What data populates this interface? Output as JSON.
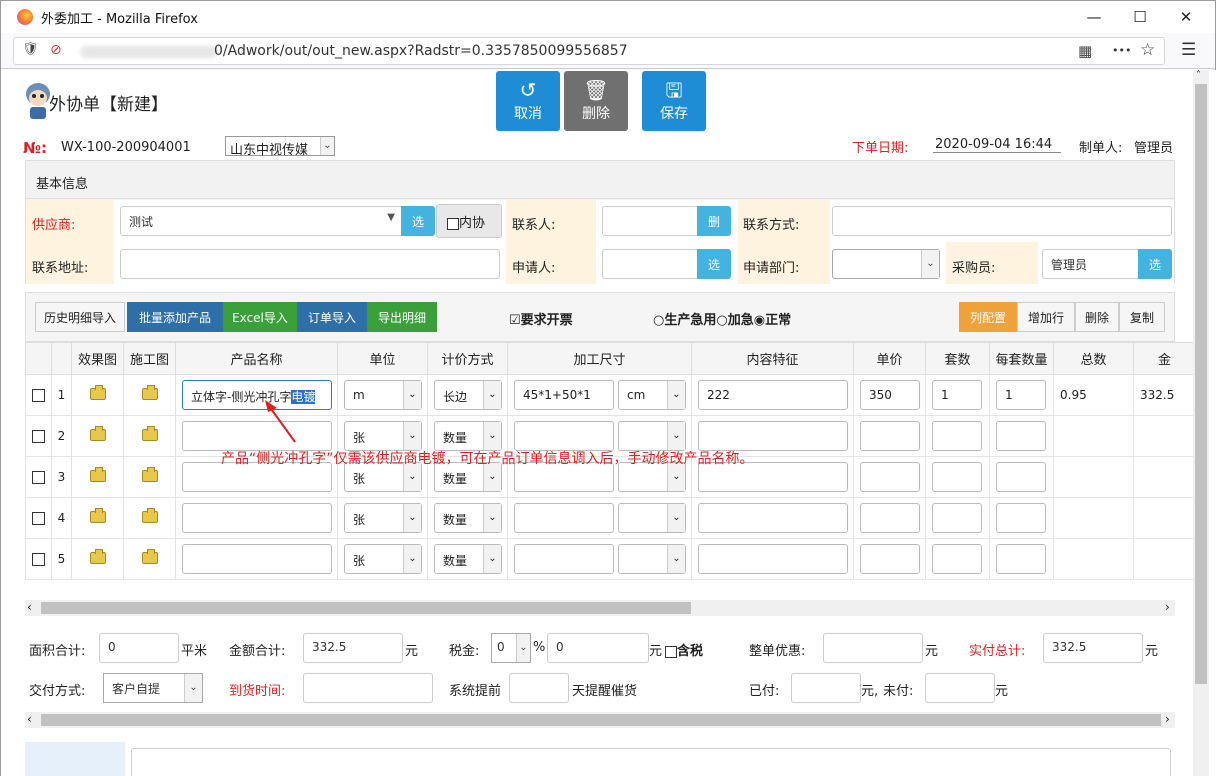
{
  "browser": {
    "window_title": "外委加工 - Mozilla Firefox",
    "url": "0/Adwork/out/out_new.aspx?Radstr=0.3357850099556857",
    "min_glyph": "—",
    "max_glyph": "☐",
    "close_glyph": "✕",
    "menu_glyph": "☰",
    "more_glyph": "•••",
    "star_glyph": "☆",
    "qr_glyph": "▦",
    "shield_glyph": "🛡",
    "lock_glyph": "⊘"
  },
  "header": {
    "title": "外协单【新建】",
    "actions": [
      {
        "label": "取消",
        "icon": "undo-icon",
        "glyph": "↺",
        "color": "#1f8dd6"
      },
      {
        "label": "删除",
        "icon": "trash-icon",
        "glyph": "🗑",
        "color": "#707070"
      },
      {
        "label": "保存",
        "icon": "save-icon",
        "glyph": "🖫",
        "color": "#1f8dd6"
      }
    ],
    "no_label": "№:",
    "order_no": "WX-100-200904001",
    "company": "山东中视传媒",
    "date_label": "下单日期:",
    "date_value": "2020-09-04 16:44",
    "maker_label": "制单人:",
    "maker_value": "管理员"
  },
  "basic": {
    "section_title": "基本信息",
    "supplier_label": "供应商:",
    "supplier_value": "测试",
    "choose_btn": "选",
    "internal_label": "内协",
    "contact_label": "联系人:",
    "contact_btn": "删",
    "contact_way_label": "联系方式:",
    "address_label": "联系地址:",
    "applicant_label": "申请人:",
    "applicant_btn": "选",
    "dept_label": "申请部门:",
    "buyer_label": "采购员:",
    "buyer_value": "管理员",
    "buyer_btn": "选"
  },
  "toolbar": {
    "history_import": "历史明细导入",
    "batch_add": "批量添加产品",
    "excel_import": "Excel导入",
    "order_import": "订单导入",
    "export_detail": "导出明细",
    "invoice_label": "要求开票",
    "urgency": [
      "生产急用",
      "加急",
      "正常"
    ],
    "col_config": "列配置",
    "add_row": "增加行",
    "delete": "删除",
    "copy": "复制"
  },
  "grid": {
    "headers": [
      "",
      "",
      "效果图",
      "施工图",
      "产品名称",
      "单位",
      "计价方式",
      "加工尺寸",
      "内容特征",
      "单价",
      "套数",
      "每套数量",
      "总数",
      "金"
    ],
    "rows": [
      {
        "no": "1",
        "name_plain": "立体字-侧光冲孔字",
        "name_sel": "电镀",
        "unit": "m",
        "price_mode": "长边",
        "size": "45*1+50*1",
        "size_unit": "cm",
        "content": "222",
        "price": "350",
        "sets": "1",
        "per_set": "1",
        "total": "0.95",
        "amount": "332.5"
      },
      {
        "no": "2",
        "unit": "张",
        "price_mode": "数量"
      },
      {
        "no": "3",
        "unit": "张",
        "price_mode": "数量"
      },
      {
        "no": "4",
        "unit": "张",
        "price_mode": "数量"
      },
      {
        "no": "5",
        "unit": "张",
        "price_mode": "数量"
      }
    ]
  },
  "annotation": "产品“侧光冲孔字”仅需该供应商电镀，可在产品订单信息调入后，手动修改产品名称。",
  "totals": {
    "area_label": "面积合计:",
    "area_value": "0",
    "area_unit": "平米",
    "amount_label": "金额合计:",
    "amount_value": "332.5",
    "amount_unit": "元",
    "tax_label": "税金:",
    "tax_rate": "0",
    "percent": "%",
    "tax_value": "0",
    "tax_unit": "元",
    "tax_incl": "含税",
    "discount_label": "整单优惠:",
    "discount_unit": "元",
    "actual_label": "实付总计:",
    "actual_value": "332.5",
    "actual_unit": "元",
    "delivery_label": "交付方式:",
    "delivery_value": "客户自提",
    "arrival_label": "到货时间:",
    "remind_label": "系统提前",
    "remind_suffix": "天提醒催货",
    "paid_label": "已付:",
    "paid_unit": "元,",
    "unpaid_label": "未付:",
    "unpaid_unit": "元"
  },
  "scroll": {
    "left": "‹",
    "right": "›",
    "up": "˄",
    "down": "˅"
  },
  "colors": {
    "blue": "#1f8dd6",
    "darkblue": "#2f6fa8",
    "green": "#3aa13a",
    "orange": "#f0a23a",
    "red": "#e02020"
  }
}
